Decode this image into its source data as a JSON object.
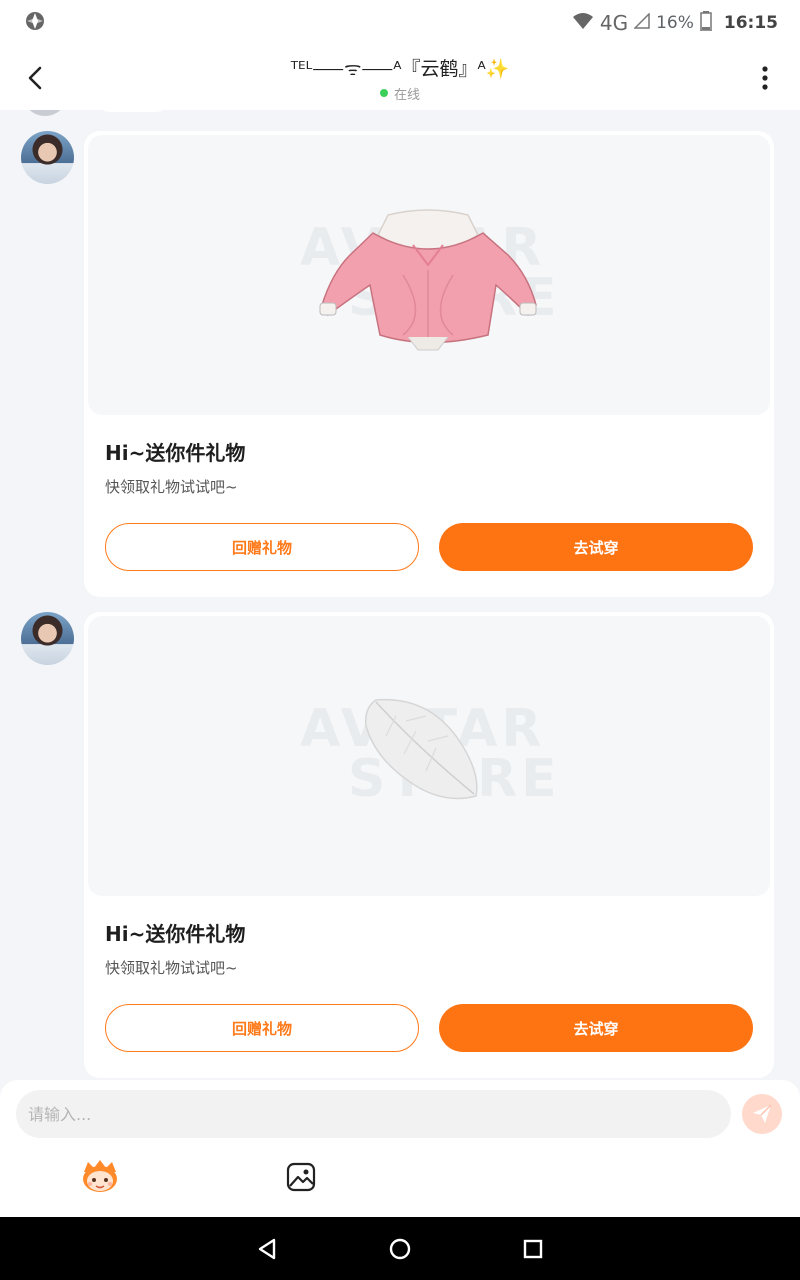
{
  "status_bar": {
    "network": "4G",
    "battery": "16%",
    "time": "16:15"
  },
  "header": {
    "title": "ᵀᴱᴸ⸺ᯤ⸺ᴬ『云鹤』ᴬ✨",
    "status": "在线"
  },
  "messages": [
    {
      "gift_item": "sweater",
      "title": "Hi~送你件礼物",
      "subtitle": "快领取礼物试试吧~",
      "return_gift_label": "回赠礼物",
      "try_on_label": "去试穿"
    },
    {
      "gift_item": "feather",
      "title": "Hi~送你件礼物",
      "subtitle": "快领取礼物试试吧~",
      "return_gift_label": "回赠礼物",
      "try_on_label": "去试穿"
    }
  ],
  "watermark": {
    "line1": "AVATAR",
    "line2": "STORE"
  },
  "input": {
    "placeholder": "请输入..."
  },
  "colors": {
    "accent": "#ff7412",
    "online": "#3ccf5a",
    "send_button_bg": "#ffd9cc"
  }
}
